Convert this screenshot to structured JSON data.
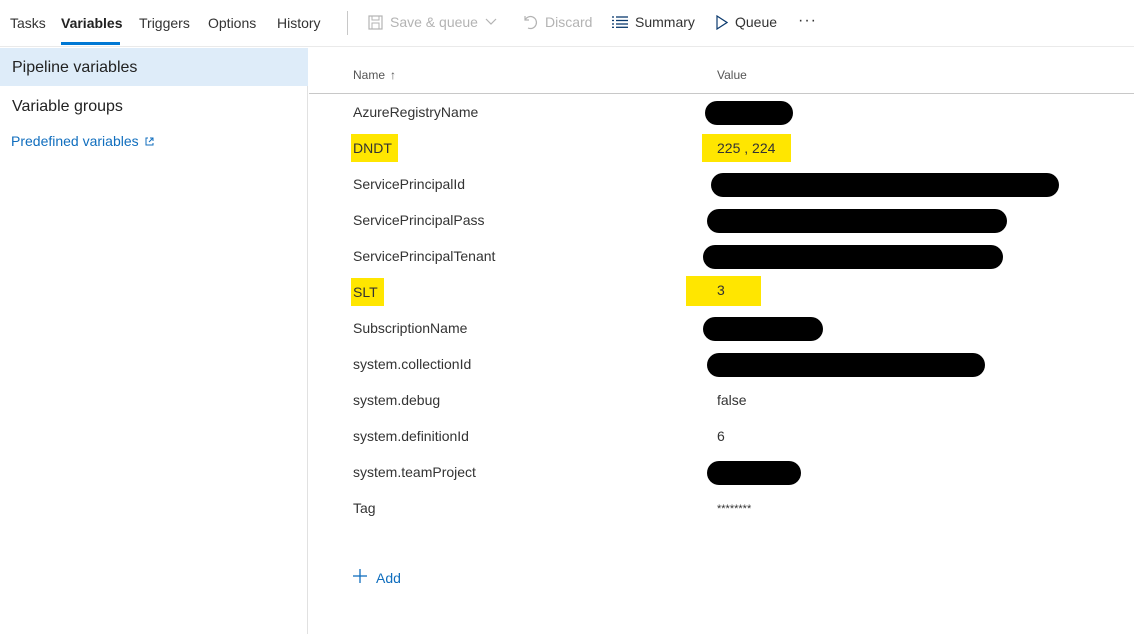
{
  "tabs": [
    {
      "label": "Tasks",
      "active": false
    },
    {
      "label": "Variables",
      "active": true
    },
    {
      "label": "Triggers",
      "active": false
    },
    {
      "label": "Options",
      "active": false
    },
    {
      "label": "History",
      "active": false
    }
  ],
  "toolbar": {
    "save_queue_label": "Save & queue",
    "discard_label": "Discard",
    "summary_label": "Summary",
    "queue_label": "Queue",
    "more_label": "···"
  },
  "sidebar": {
    "items": [
      {
        "label": "Pipeline variables",
        "selected": true
      },
      {
        "label": "Variable groups",
        "selected": false
      }
    ],
    "link_label": "Predefined variables"
  },
  "table": {
    "columns": {
      "name": "Name",
      "value": "Value"
    },
    "sort_indicator": "↑",
    "rows": [
      {
        "name": "AzureRegistryName",
        "value": "",
        "redacted": true,
        "highlighted": false
      },
      {
        "name": "DNDT",
        "value": "225 , 224",
        "redacted": false,
        "highlighted": true
      },
      {
        "name": "ServicePrincipalId",
        "value": "",
        "redacted": true,
        "highlighted": false
      },
      {
        "name": "ServicePrincipalPass",
        "value": "",
        "redacted": true,
        "highlighted": false
      },
      {
        "name": "ServicePrincipalTenant",
        "value": "",
        "redacted": true,
        "highlighted": false
      },
      {
        "name": "SLT",
        "value": "3",
        "redacted": false,
        "highlighted": true
      },
      {
        "name": "SubscriptionName",
        "value": "",
        "redacted": true,
        "highlighted": false
      },
      {
        "name": "system.collectionId",
        "value": "",
        "redacted": true,
        "highlighted": false
      },
      {
        "name": "system.debug",
        "value": "false",
        "redacted": false,
        "highlighted": false
      },
      {
        "name": "system.definitionId",
        "value": "6",
        "redacted": false,
        "highlighted": false
      },
      {
        "name": "system.teamProject",
        "value": "",
        "redacted": true,
        "highlighted": false
      },
      {
        "name": "Tag",
        "value": "********",
        "redacted": false,
        "highlighted": false
      }
    ]
  },
  "add_label": "Add",
  "colors": {
    "accent": "#0078d4",
    "link": "#106ebe",
    "selected_bg": "#deecf9",
    "highlight": "#ffe600"
  }
}
